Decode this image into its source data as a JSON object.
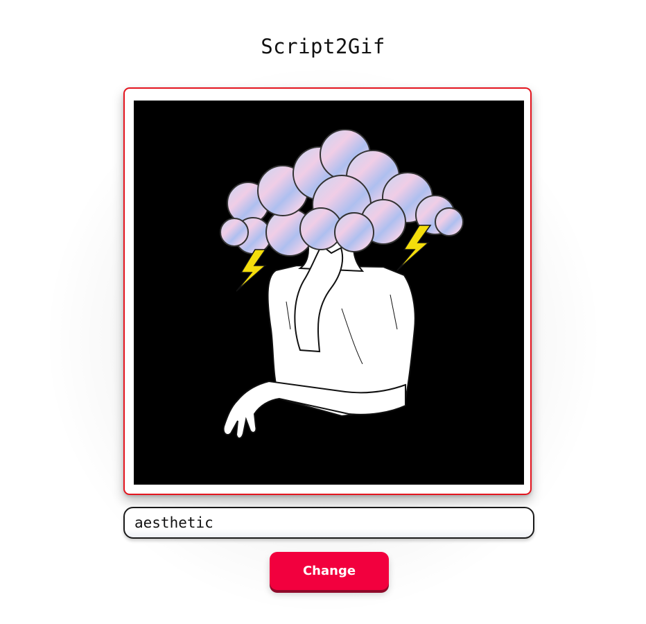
{
  "header": {
    "title": "Script2Gif"
  },
  "gif_preview": {
    "icon": "cloud-head-illustration",
    "colors": {
      "frame_border": "#e4141e",
      "background": "#000000",
      "lightning": "#f4dd0c"
    }
  },
  "search": {
    "value": "aesthetic"
  },
  "actions": {
    "change_label": "Change",
    "accent": "#f2003e"
  }
}
